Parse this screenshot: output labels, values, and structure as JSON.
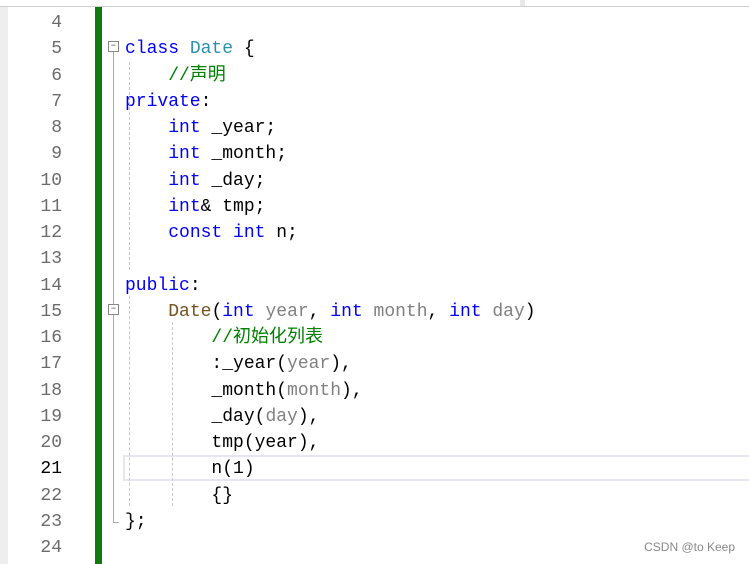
{
  "editor": {
    "current_line": 21,
    "lines": [
      {
        "n": "4",
        "tokens": []
      },
      {
        "n": "5",
        "tokens": [
          [
            "class ",
            "kw"
          ],
          [
            "Date",
            "ty"
          ],
          [
            " {",
            ""
          ]
        ]
      },
      {
        "n": "6",
        "tokens": [
          [
            "    //声明",
            "cm"
          ]
        ]
      },
      {
        "n": "7",
        "tokens": [
          [
            "private",
            "kw"
          ],
          [
            ":",
            ""
          ]
        ]
      },
      {
        "n": "8",
        "tokens": [
          [
            "    ",
            ""
          ],
          [
            "int",
            "kw"
          ],
          [
            " _year;",
            ""
          ]
        ]
      },
      {
        "n": "9",
        "tokens": [
          [
            "    ",
            ""
          ],
          [
            "int",
            "kw"
          ],
          [
            " _month;",
            ""
          ]
        ]
      },
      {
        "n": "10",
        "tokens": [
          [
            "    ",
            ""
          ],
          [
            "int",
            "kw"
          ],
          [
            " _day;",
            ""
          ]
        ]
      },
      {
        "n": "11",
        "tokens": [
          [
            "    ",
            ""
          ],
          [
            "int",
            "kw"
          ],
          [
            "& tmp;",
            ""
          ]
        ]
      },
      {
        "n": "12",
        "tokens": [
          [
            "    ",
            ""
          ],
          [
            "const",
            "kw"
          ],
          [
            " ",
            ""
          ],
          [
            "int",
            "kw"
          ],
          [
            " n;",
            ""
          ]
        ]
      },
      {
        "n": "13",
        "tokens": []
      },
      {
        "n": "14",
        "tokens": [
          [
            "public",
            "kw"
          ],
          [
            ":",
            ""
          ]
        ]
      },
      {
        "n": "15",
        "tokens": [
          [
            "    ",
            ""
          ],
          [
            "Date",
            "fn"
          ],
          [
            "(",
            ""
          ],
          [
            "int",
            "kw"
          ],
          [
            " ",
            ""
          ],
          [
            "year",
            "pa"
          ],
          [
            ", ",
            ""
          ],
          [
            "int",
            "kw"
          ],
          [
            " ",
            ""
          ],
          [
            "month",
            "pa"
          ],
          [
            ", ",
            ""
          ],
          [
            "int",
            "kw"
          ],
          [
            " ",
            ""
          ],
          [
            "day",
            "pa"
          ],
          [
            ")",
            ""
          ]
        ]
      },
      {
        "n": "16",
        "tokens": [
          [
            "        //初始化列表",
            "cm"
          ]
        ]
      },
      {
        "n": "17",
        "tokens": [
          [
            "        :_year(",
            ""
          ],
          [
            "year",
            "pa"
          ],
          [
            "),",
            ""
          ]
        ]
      },
      {
        "n": "18",
        "tokens": [
          [
            "        _month(",
            ""
          ],
          [
            "month",
            "pa"
          ],
          [
            "),",
            ""
          ]
        ]
      },
      {
        "n": "19",
        "tokens": [
          [
            "        _day(",
            ""
          ],
          [
            "day",
            "pa"
          ],
          [
            "),",
            ""
          ]
        ]
      },
      {
        "n": "20",
        "tokens": [
          [
            "        tmp(year),",
            ""
          ]
        ]
      },
      {
        "n": "21",
        "tokens": [
          [
            "        n(1)",
            ""
          ]
        ]
      },
      {
        "n": "22",
        "tokens": [
          [
            "        {}",
            ""
          ]
        ]
      },
      {
        "n": "23",
        "tokens": [
          [
            "};",
            ""
          ]
        ]
      },
      {
        "n": "24",
        "tokens": []
      }
    ]
  },
  "watermark": "CSDN @to Keep"
}
